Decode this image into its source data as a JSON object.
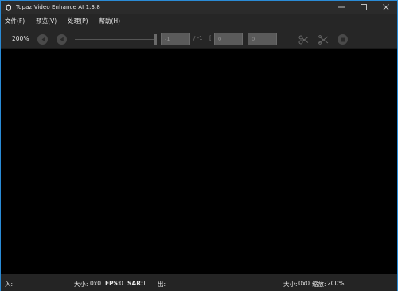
{
  "window": {
    "title": "Topaz Video Enhance AI 1.3.8",
    "controls": {
      "minimize": "—",
      "maximize": "☐",
      "close": "✕"
    }
  },
  "menu": {
    "items": [
      {
        "label": "文件(F)"
      },
      {
        "label": "预览(V)"
      },
      {
        "label": "处理(P)"
      },
      {
        "label": "帮助(H)"
      }
    ]
  },
  "toolbar": {
    "zoom": "200%",
    "frame_current": "-1",
    "frame_separator": "/ -1",
    "range_bracket_open": "[",
    "range_start": "0",
    "range_end": "0",
    "icons": [
      "skip-back-icon",
      "step-back-icon",
      "scissors-icon",
      "cut-range-icon",
      "stop-icon"
    ]
  },
  "status": {
    "input_label": "入:",
    "input_size_label": "大小:",
    "input_size_value": "0x0",
    "fps_label": "FPS:",
    "fps_value": "0",
    "sar_label": "SAR:",
    "sar_value": "1",
    "output_label": "出:",
    "output_size_label": "大小:",
    "output_size_value": "0x0",
    "scale_label": "缩放:",
    "scale_value": "200%"
  },
  "colors": {
    "titlebar": "#2b2b2b",
    "toolbar": "#262626",
    "viewport": "#000000",
    "window_border": "#2a8bd6"
  }
}
